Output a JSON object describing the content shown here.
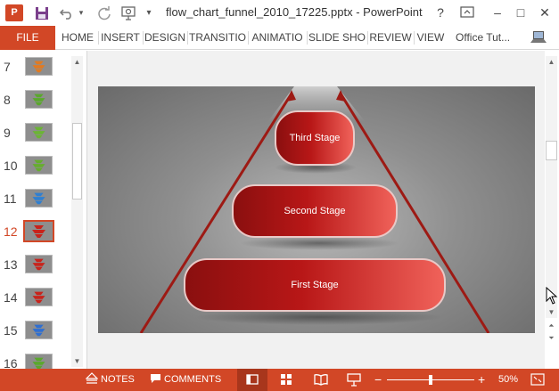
{
  "window": {
    "title": "flow_chart_funnel_2010_17225.pptx - PowerPoint",
    "app_icon_label": "P",
    "help_label": "?",
    "quick_access": [
      "save-icon",
      "undo-icon",
      "redo-icon",
      "present-icon",
      "customize-icon"
    ]
  },
  "ribbon": {
    "file_label": "FILE",
    "tabs": [
      "HOME",
      "INSERT",
      "DESIGN",
      "TRANSITIO",
      "ANIMATIO",
      "SLIDE SHO",
      "REVIEW",
      "VIEW"
    ],
    "account_label": "Office Tut..."
  },
  "thumbnails": {
    "selected": "12",
    "items": [
      {
        "num": "7",
        "color": "#e07a22"
      },
      {
        "num": "8",
        "color": "#5aa82c"
      },
      {
        "num": "9",
        "color": "#6bb534"
      },
      {
        "num": "10",
        "color": "#66ad2e"
      },
      {
        "num": "11",
        "color": "#2f7fd1"
      },
      {
        "num": "12",
        "color": "#c8231b"
      },
      {
        "num": "13",
        "color": "#c8231b"
      },
      {
        "num": "14",
        "color": "#c8231b"
      },
      {
        "num": "15",
        "color": "#2f6fd1"
      },
      {
        "num": "16",
        "color": "#5aa82c"
      }
    ]
  },
  "slide": {
    "stages": [
      "Third Stage",
      "Second Stage",
      "First Stage"
    ],
    "accent_color": "#b81717",
    "line_color": "#9d1a14"
  },
  "statusbar": {
    "notes_label": "NOTES",
    "comments_label": "COMMENTS",
    "zoom_label": "50%",
    "zoom_level": 0.5,
    "background_color": "#d24726"
  }
}
